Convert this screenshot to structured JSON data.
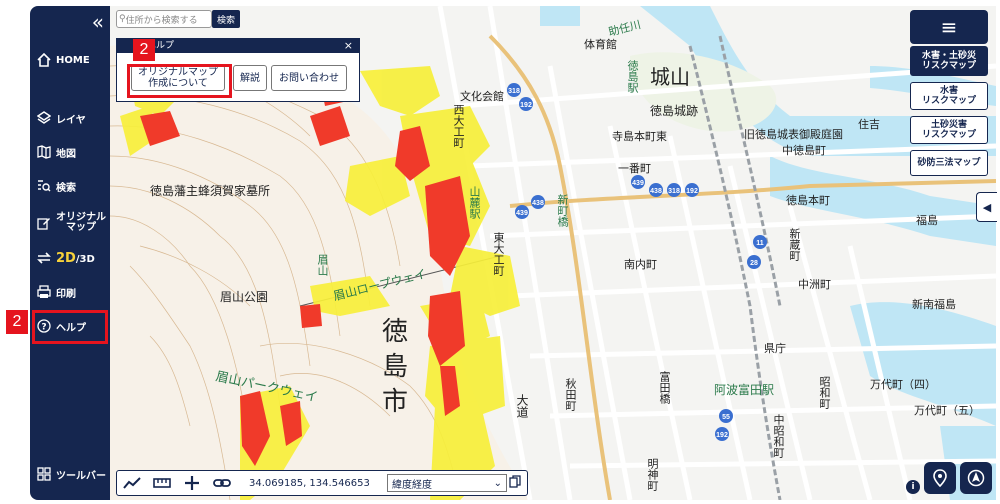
{
  "sidebar": {
    "collapse_icon": "double-chevron-left-icon",
    "items": [
      {
        "label": "HOME",
        "icon": "home-icon"
      },
      {
        "label": "レイヤ",
        "icon": "layers-icon"
      },
      {
        "label": "地図",
        "icon": "map-icon"
      },
      {
        "label": "検索",
        "icon": "search-list-icon"
      },
      {
        "label": "オリジナル\nマップ",
        "icon": "edit-icon"
      },
      {
        "label": "2D",
        "label2": "/3D",
        "icon": "switch-icon"
      },
      {
        "label": "印刷",
        "icon": "printer-icon"
      },
      {
        "label": "ヘルプ",
        "icon": "help-icon"
      },
      {
        "label": "ツールバー",
        "icon": "grid-icon"
      }
    ]
  },
  "search": {
    "placeholder": "住所から検索する",
    "button": "検索"
  },
  "popup": {
    "title": "ヘルプ",
    "close": "×",
    "buttons": [
      {
        "label": "オリジナルマップ\n作成について"
      },
      {
        "label": "解説"
      },
      {
        "label": "お問い合わせ"
      }
    ]
  },
  "badges": {
    "sidebar": "2",
    "popup": "2"
  },
  "right_panel": {
    "menu_icon": "hamburger-icon",
    "buttons": [
      {
        "label": "水害・土砂災\nリスクマップ",
        "active": true
      },
      {
        "label": "水害\nリスクマップ",
        "active": false
      },
      {
        "label": "土砂災害\nリスクマップ",
        "active": false
      },
      {
        "label": "砂防三法マップ",
        "active": false
      }
    ],
    "side_tab": "◀"
  },
  "toolbar": {
    "coords": "34.069185, 134.546653",
    "format": "緯度経度"
  },
  "map_labels": {
    "tokushima_shi_1": "徳",
    "tokushima_shi_2": "島",
    "tokushima_shi_3": "市",
    "shiroyama": "城山",
    "tokushima_jo": "徳島城跡",
    "bizan_park": "眉山公園",
    "bizan_parkway": "眉山パークウェイ",
    "hachisuka": "徳島藩主蜂須賀家墓所",
    "ropeway": "眉山ロープウェイ",
    "tokushima_eki": "徳島駅",
    "awa_tomida": "阿波富田駅",
    "sakanoue": "大道",
    "tokushima_honcho": "徳島本町",
    "terashima": "寺島本町東",
    "ichibancho": "一番町",
    "shinzoucho": "新蔵町",
    "minamiuchimachi": "南内町",
    "tomida": "富田橋",
    "bunka": "文化会館",
    "nishi": "西大工町",
    "higashi": "東大工町",
    "chunai": "中洲町",
    "minami": "新南福島",
    "fukushima": "福島",
    "mandai": "万代町（四）",
    "mandai5": "万代町（五）",
    "akita": "秋田町",
    "meijin": "明神町",
    "showa": "昭和町",
    "chuo": "中昭和町",
    "kencho": "県庁",
    "sumiyoshi": "住吉",
    "old_palace": "旧徳島城表御殿庭園",
    "naka": "中徳島町",
    "yamaguchi": "山麓駅",
    "bizan": "眉山",
    "kinsei": "新町橋",
    "taiikukan": "体育館",
    "tokushima_oohashi": "助任川",
    "number_318": "318",
    "number_192": "192",
    "number_438": "438",
    "number_439": "439",
    "number_11": "11",
    "number_28": "28",
    "number_55": "55",
    "info": "i"
  },
  "colors": {
    "navy": "#15264f",
    "red_highlight": "#e5141e",
    "hazard_red": "#f03a2a",
    "hazard_yellow": "#f7ef3a",
    "river": "#bfe6f5"
  }
}
